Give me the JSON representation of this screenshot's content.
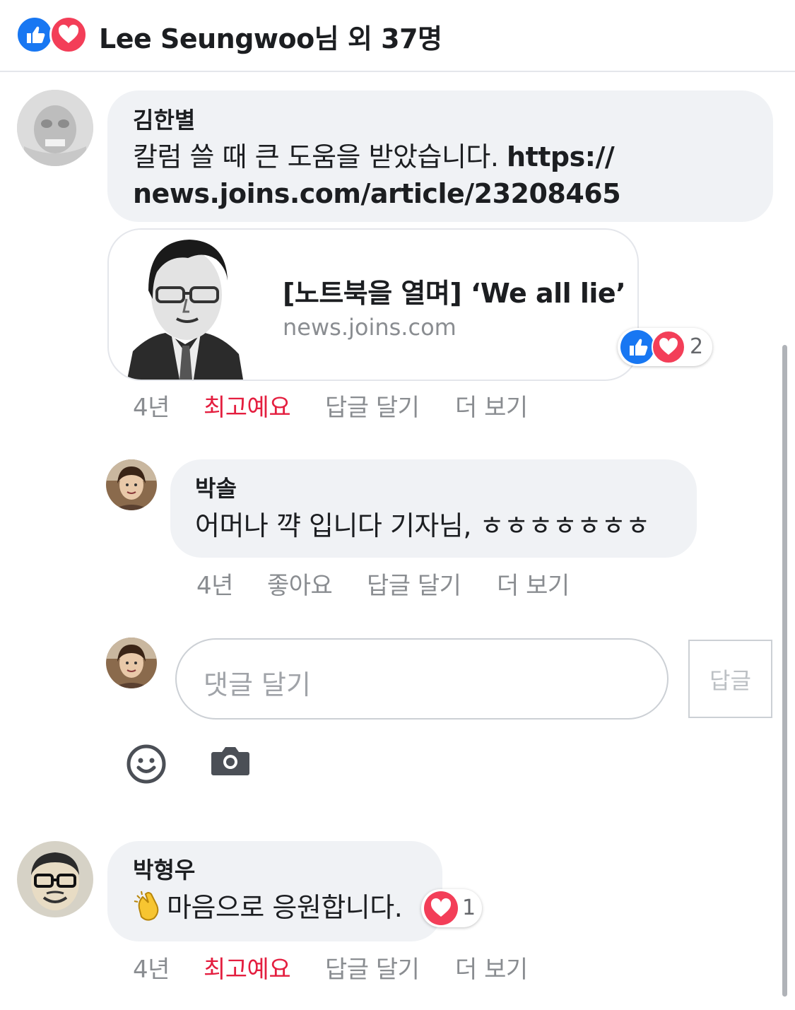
{
  "header": {
    "reactions_icons": [
      "like-icon",
      "love-icon"
    ],
    "summary": "Lee Seungwoo님 외 37명"
  },
  "comments": [
    {
      "author": "김한별",
      "text_line1": "칼럼 쓸 때 큰 도움을 받았습니다. ",
      "link_part1": "https://",
      "link_part2": "news.joins.com/article/23208465",
      "link_card": {
        "title": "[노트북을 열며] ‘We all lie’",
        "domain": "news.joins.com"
      },
      "reaction_count": "2",
      "actions": {
        "time": "4년",
        "reaction": "최고예요",
        "reply": "답글 달기",
        "more": "더 보기"
      }
    },
    {
      "author": "박솔",
      "text": "어머나 꺅 입니다 기자님, ㅎㅎㅎㅎㅎㅎㅎ",
      "actions": {
        "time": "4년",
        "reaction": "좋아요",
        "reply": "답글 달기",
        "more": "더 보기"
      }
    },
    {
      "author": "박형우",
      "emoji": "👏",
      "text": "마음으로 응원합니다.",
      "reaction_count": "1",
      "actions": {
        "time": "4년",
        "reaction": "최고예요",
        "reply": "답글 달기",
        "more": "더 보기"
      }
    }
  ],
  "reply_box": {
    "placeholder": "댓글 달기",
    "submit_label": "답글",
    "icons": [
      "emoji-smile-icon",
      "camera-icon"
    ]
  },
  "colors": {
    "like_blue": "#1877f2",
    "love_red": "#f33e58",
    "reaction_active_red": "#e41e3f",
    "bubble_bg": "#f0f2f5",
    "muted_text": "#8a8d91"
  }
}
